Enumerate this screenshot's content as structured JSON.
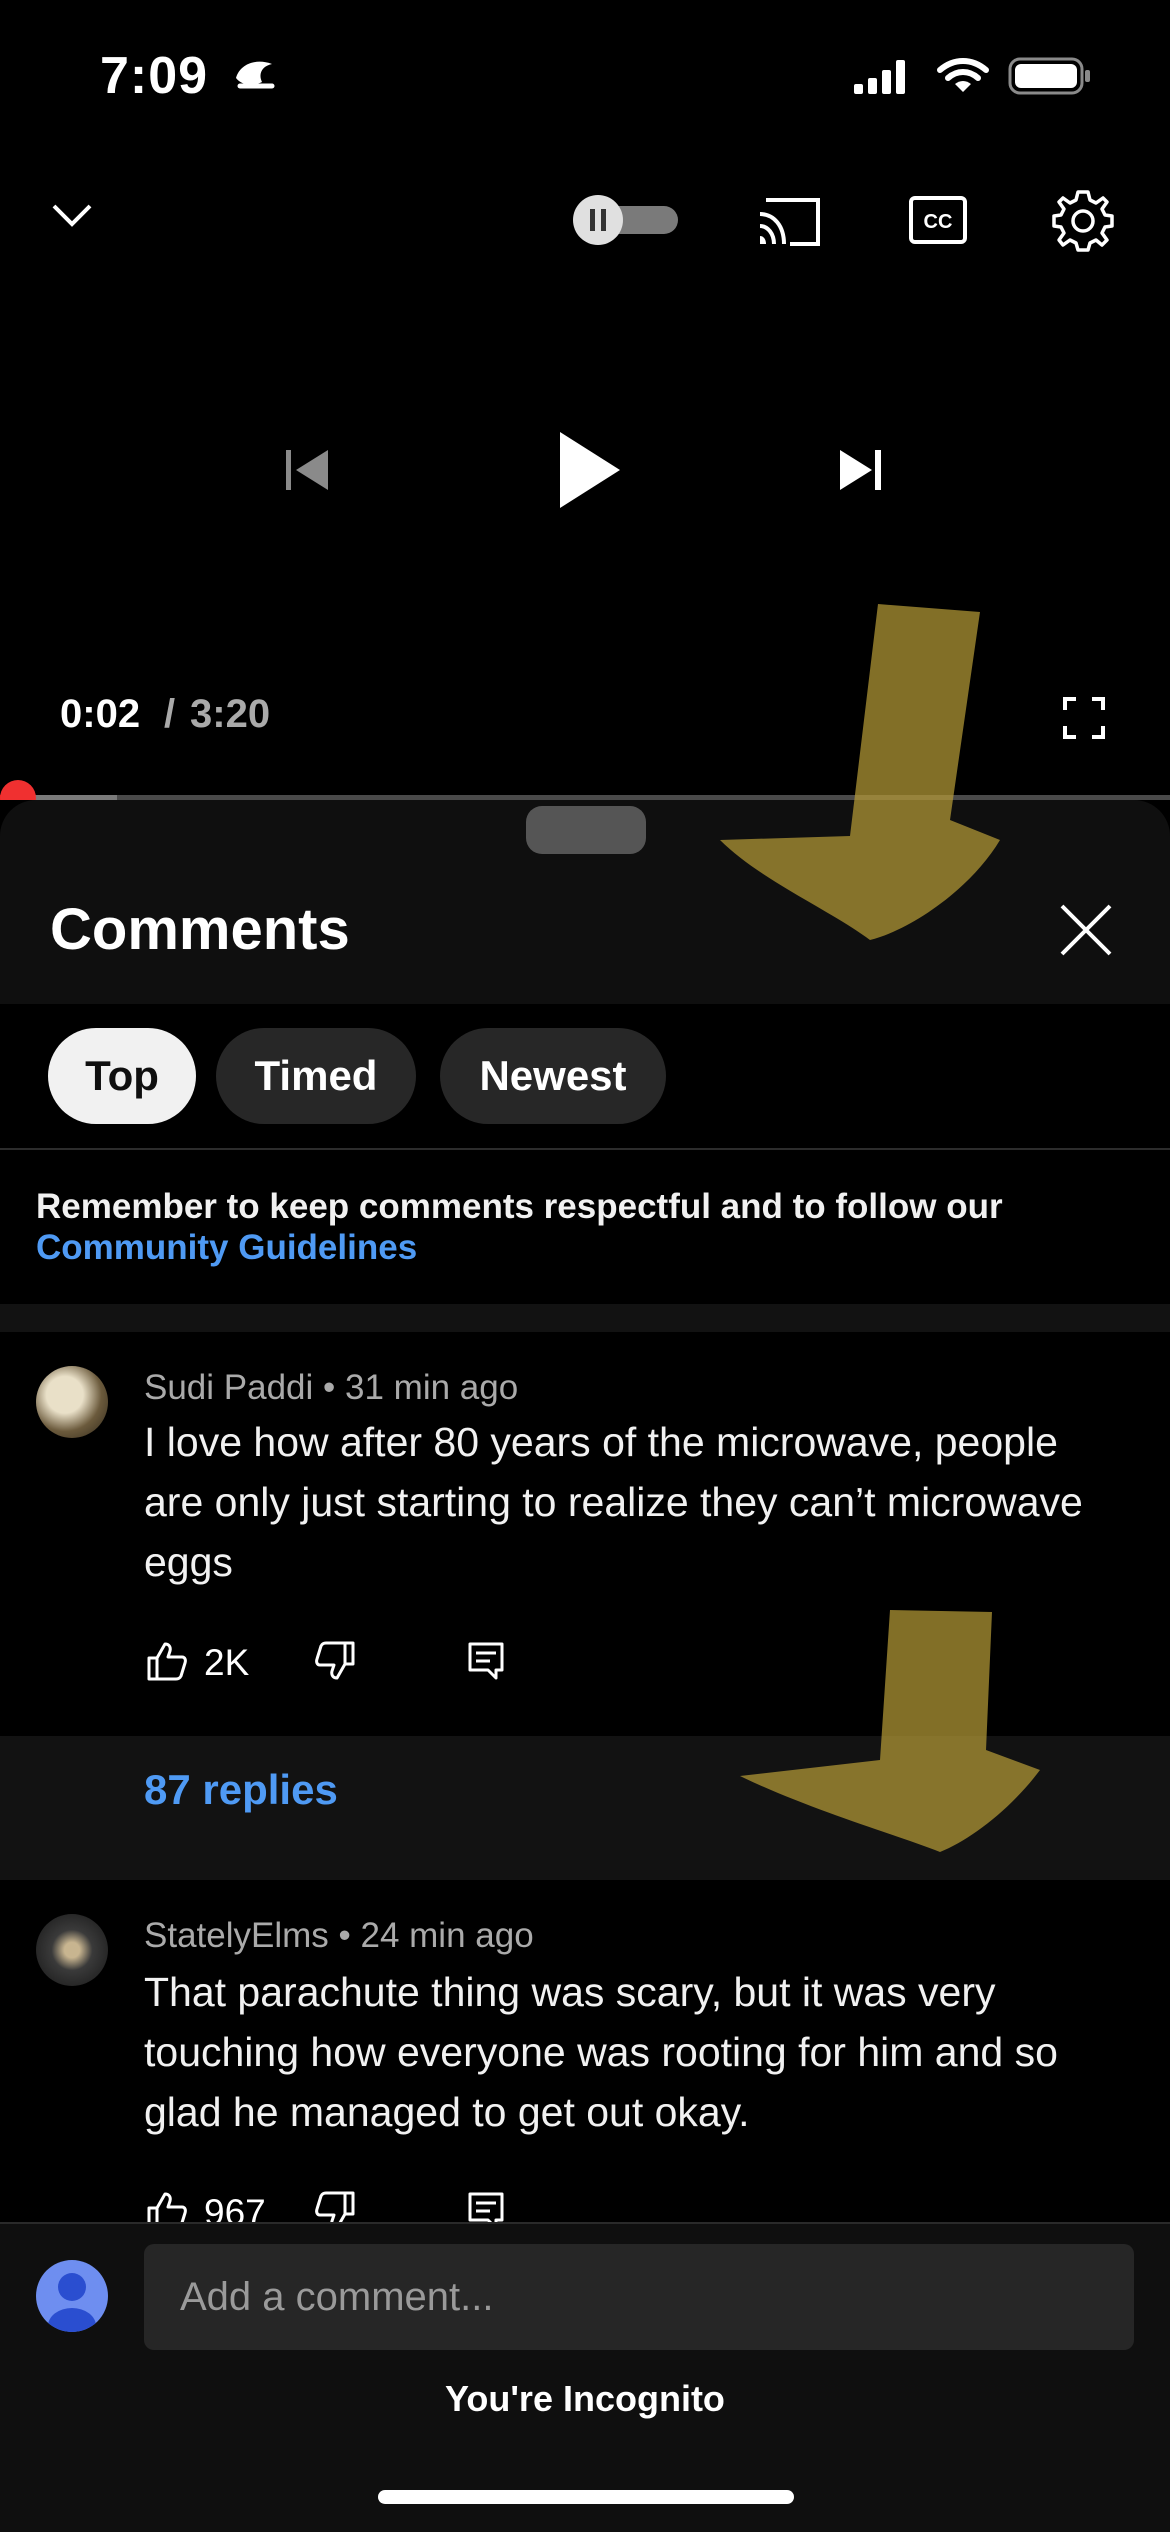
{
  "status_bar": {
    "time": "7:09"
  },
  "player": {
    "current_time": "0:02",
    "separator": "/",
    "duration": "3:20",
    "progress_fraction": 0.01,
    "buffer_fraction": 0.1
  },
  "comments_panel": {
    "title": "Comments",
    "chips": [
      {
        "label": "Top",
        "selected": true
      },
      {
        "label": "Timed",
        "selected": false
      },
      {
        "label": "Newest",
        "selected": false
      }
    ],
    "notice": {
      "text": "Remember to keep comments respectful and to follow our",
      "link": "Community Guidelines"
    },
    "comments": [
      {
        "author": "Sudi Paddi",
        "age": "31 min ago",
        "text": "I love how after 80 years of the microwave, people are only just starting to realize they can’t microwave eggs",
        "likes": "2K",
        "replies": "87 replies"
      },
      {
        "author": "StatelyElms",
        "age": "24 min ago",
        "text": "That parachute thing was scary, but it was very touching how everyone was rooting for him and so glad he managed to get out okay.",
        "likes": "967"
      }
    ],
    "input": {
      "placeholder": "Add a comment..."
    },
    "incognito_label": "You're Incognito"
  },
  "colors": {
    "accent_red": "#ff0000",
    "link_blue": "#4f9af4",
    "annotation_arrow": "#b59a37"
  },
  "icons": [
    "moon-icon",
    "signal-icon",
    "wifi-icon",
    "battery-icon",
    "chevron-down-icon",
    "pause-icon",
    "cast-icon",
    "cc-icon",
    "gear-icon",
    "previous-icon",
    "play-icon",
    "next-icon",
    "fullscreen-icon",
    "close-icon",
    "thumb-up-icon",
    "thumb-down-icon",
    "reply-icon",
    "user-icon"
  ]
}
